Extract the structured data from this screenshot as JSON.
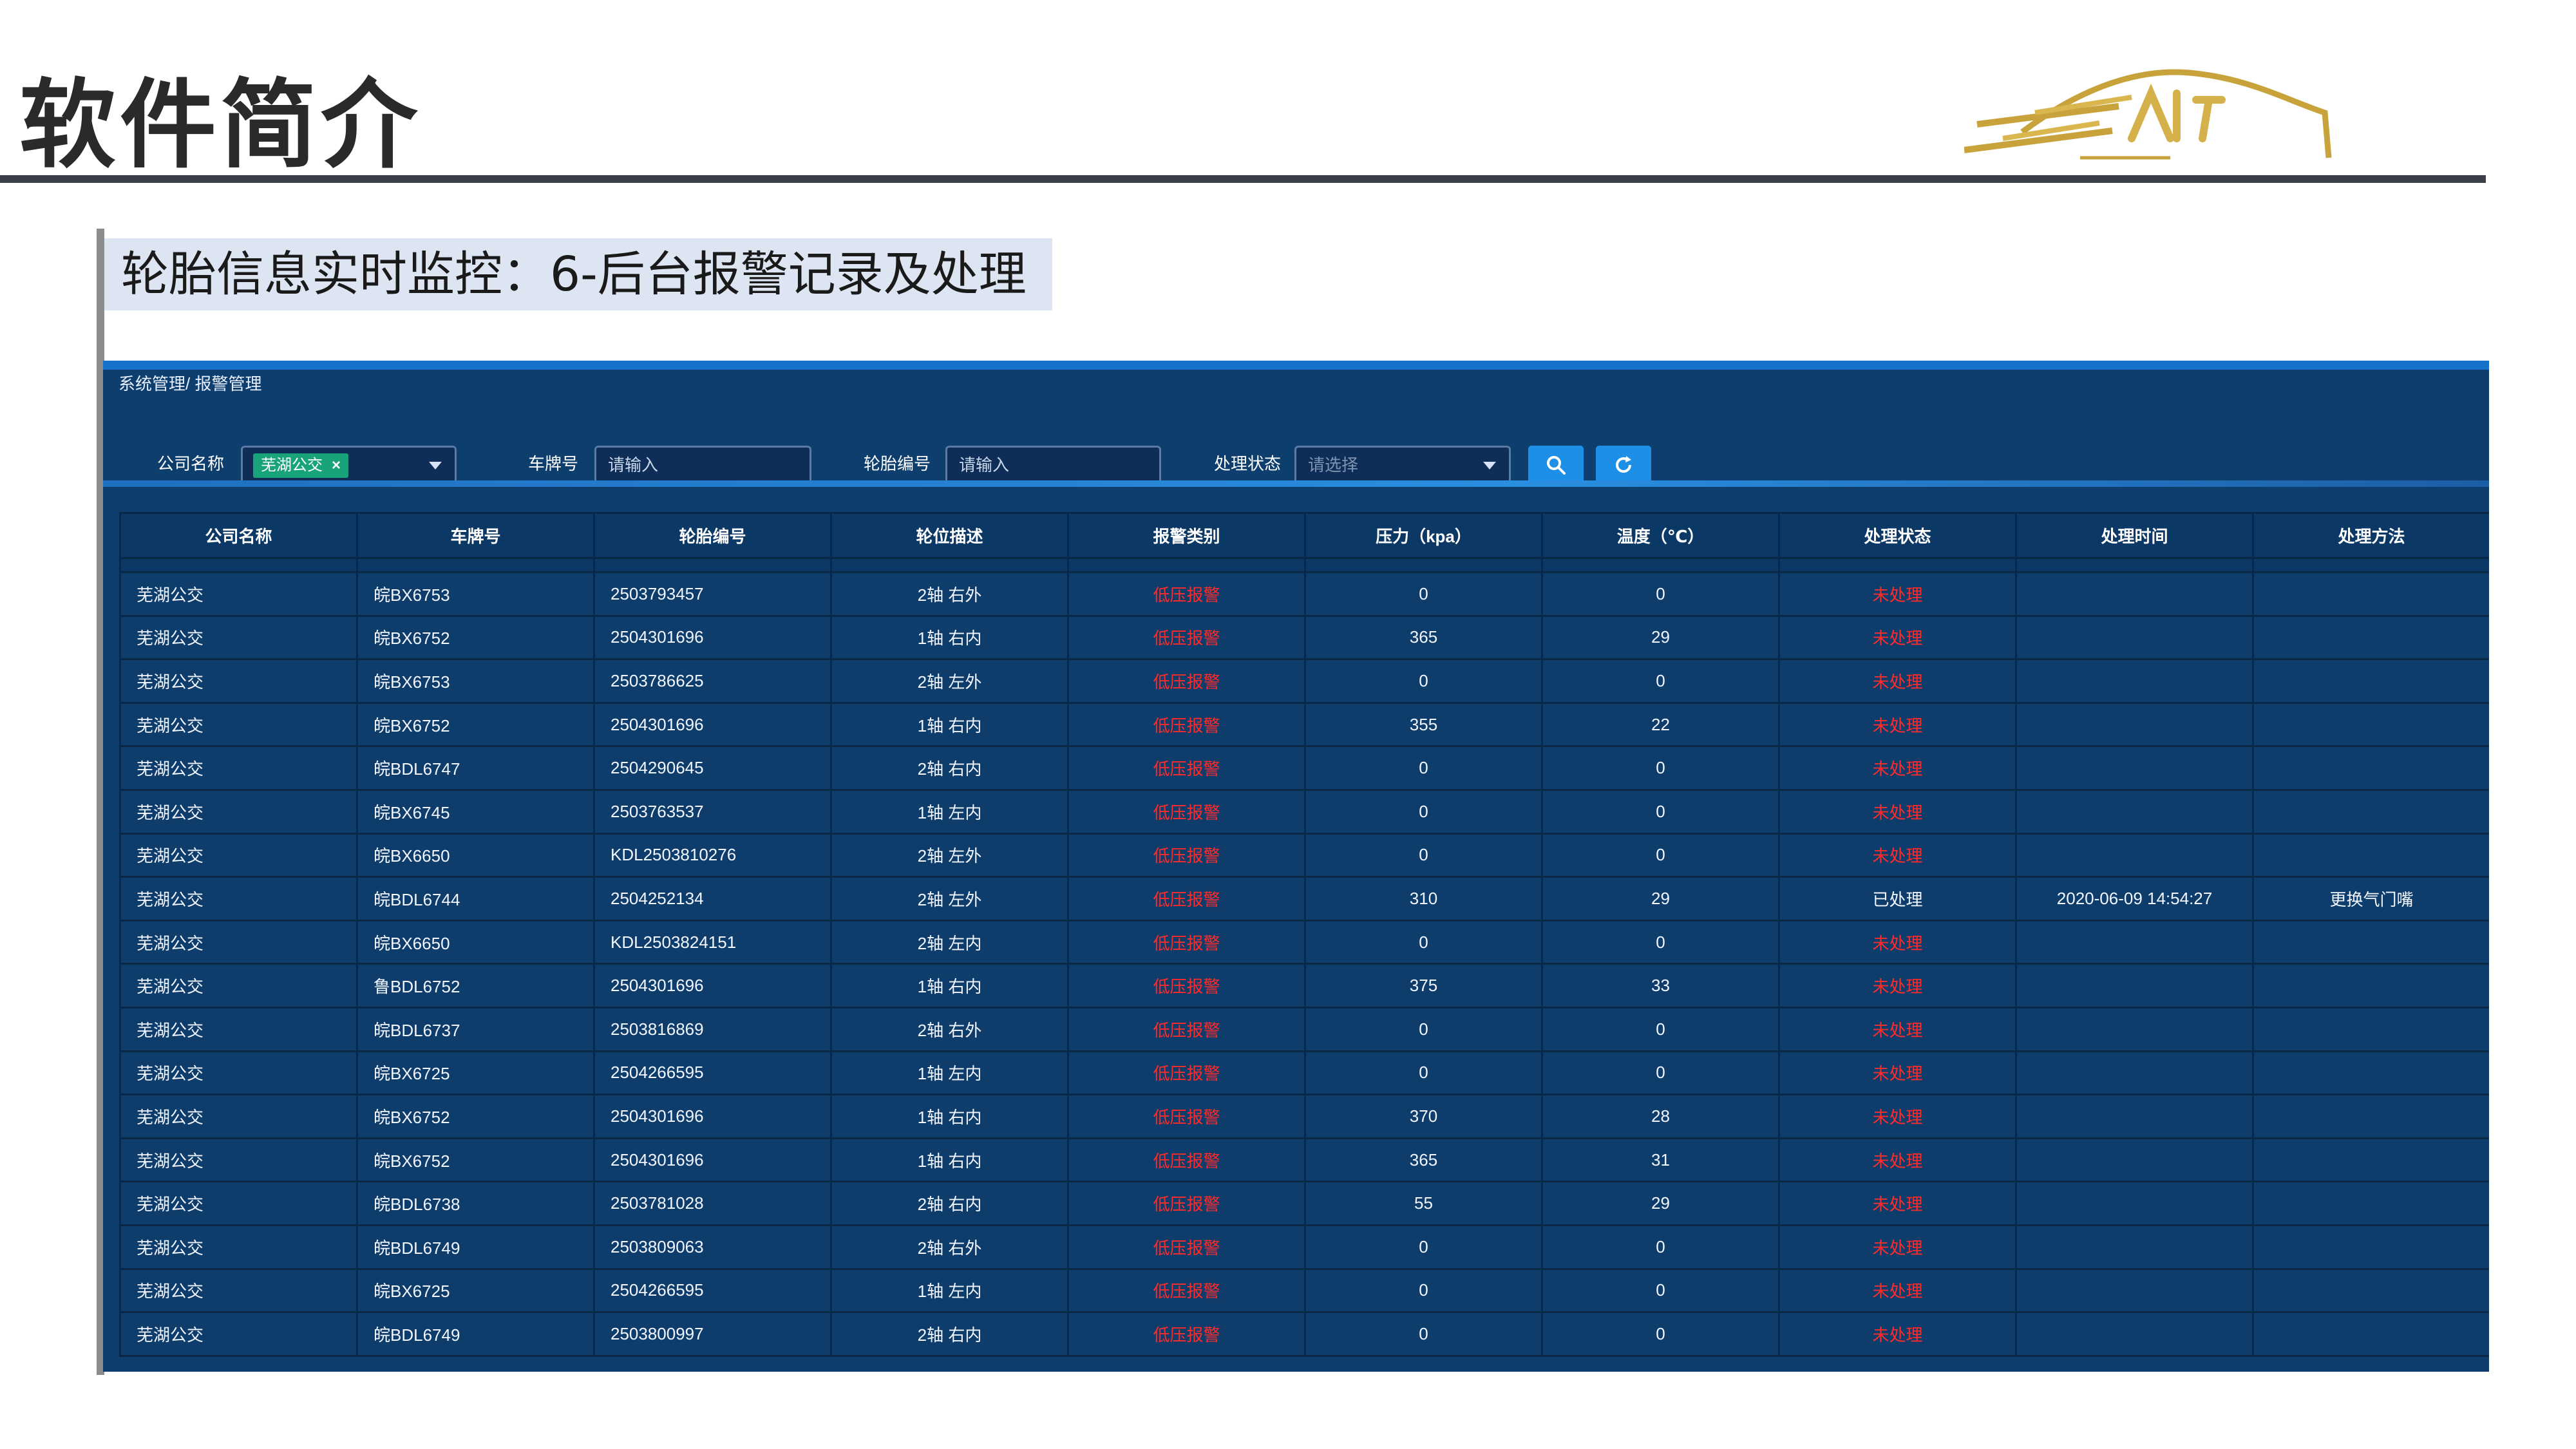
{
  "slide": {
    "title": "软件简介",
    "section_label": "轮胎信息实时监控：6-后台报警记录及处理"
  },
  "app": {
    "breadcrumb": "系统管理/ 报警管理",
    "filters": {
      "company_label": "公司名称",
      "company_tag": "芜湖公交",
      "plate_label": "车牌号",
      "plate_placeholder": "请输入",
      "tire_label": "轮胎编号",
      "tire_placeholder": "请输入",
      "status_label": "处理状态",
      "status_placeholder": "请选择"
    },
    "colors": {
      "accent": "#1d8fe6",
      "panel": "#0d3e6e",
      "alert": "#ff2a2a",
      "tag": "#19a37a"
    },
    "table": {
      "headers": [
        "公司名称",
        "车牌号",
        "轮胎编号",
        "轮位描述",
        "报警类别",
        "压力（kpa）",
        "温度（℃）",
        "处理状态",
        "处理时间",
        "处理方法"
      ],
      "rows": [
        [
          "芜湖公交",
          "皖BX6753",
          "2503793457",
          "2轴 右外",
          "低压报警",
          "0",
          "0",
          "未处理",
          "",
          ""
        ],
        [
          "芜湖公交",
          "皖BX6752",
          "2504301696",
          "1轴 右内",
          "低压报警",
          "365",
          "29",
          "未处理",
          "",
          ""
        ],
        [
          "芜湖公交",
          "皖BX6753",
          "2503786625",
          "2轴 左外",
          "低压报警",
          "0",
          "0",
          "未处理",
          "",
          ""
        ],
        [
          "芜湖公交",
          "皖BX6752",
          "2504301696",
          "1轴 右内",
          "低压报警",
          "355",
          "22",
          "未处理",
          "",
          ""
        ],
        [
          "芜湖公交",
          "皖BDL6747",
          "2504290645",
          "2轴 右内",
          "低压报警",
          "0",
          "0",
          "未处理",
          "",
          ""
        ],
        [
          "芜湖公交",
          "皖BX6745",
          "2503763537",
          "1轴 左内",
          "低压报警",
          "0",
          "0",
          "未处理",
          "",
          ""
        ],
        [
          "芜湖公交",
          "皖BX6650",
          "KDL2503810276",
          "2轴 左外",
          "低压报警",
          "0",
          "0",
          "未处理",
          "",
          ""
        ],
        [
          "芜湖公交",
          "皖BDL6744",
          "2504252134",
          "2轴 左外",
          "低压报警",
          "310",
          "29",
          "已处理",
          "2020-06-09 14:54:27",
          "更换气门嘴"
        ],
        [
          "芜湖公交",
          "皖BX6650",
          "KDL2503824151",
          "2轴 左内",
          "低压报警",
          "0",
          "0",
          "未处理",
          "",
          ""
        ],
        [
          "芜湖公交",
          "鲁BDL6752",
          "2504301696",
          "1轴 右内",
          "低压报警",
          "375",
          "33",
          "未处理",
          "",
          ""
        ],
        [
          "芜湖公交",
          "皖BDL6737",
          "2503816869",
          "2轴 右外",
          "低压报警",
          "0",
          "0",
          "未处理",
          "",
          ""
        ],
        [
          "芜湖公交",
          "皖BX6725",
          "2504266595",
          "1轴 左内",
          "低压报警",
          "0",
          "0",
          "未处理",
          "",
          ""
        ],
        [
          "芜湖公交",
          "皖BX6752",
          "2504301696",
          "1轴 右内",
          "低压报警",
          "370",
          "28",
          "未处理",
          "",
          ""
        ],
        [
          "芜湖公交",
          "皖BX6752",
          "2504301696",
          "1轴 右内",
          "低压报警",
          "365",
          "31",
          "未处理",
          "",
          ""
        ],
        [
          "芜湖公交",
          "皖BDL6738",
          "2503781028",
          "2轴 右内",
          "低压报警",
          "55",
          "29",
          "未处理",
          "",
          ""
        ],
        [
          "芜湖公交",
          "皖BDL6749",
          "2503809063",
          "2轴 右外",
          "低压报警",
          "0",
          "0",
          "未处理",
          "",
          ""
        ],
        [
          "芜湖公交",
          "皖BX6725",
          "2504266595",
          "1轴 左内",
          "低压报警",
          "0",
          "0",
          "未处理",
          "",
          ""
        ],
        [
          "芜湖公交",
          "皖BDL6749",
          "2503800997",
          "2轴 右内",
          "低压报警",
          "0",
          "0",
          "未处理",
          "",
          ""
        ]
      ]
    }
  }
}
